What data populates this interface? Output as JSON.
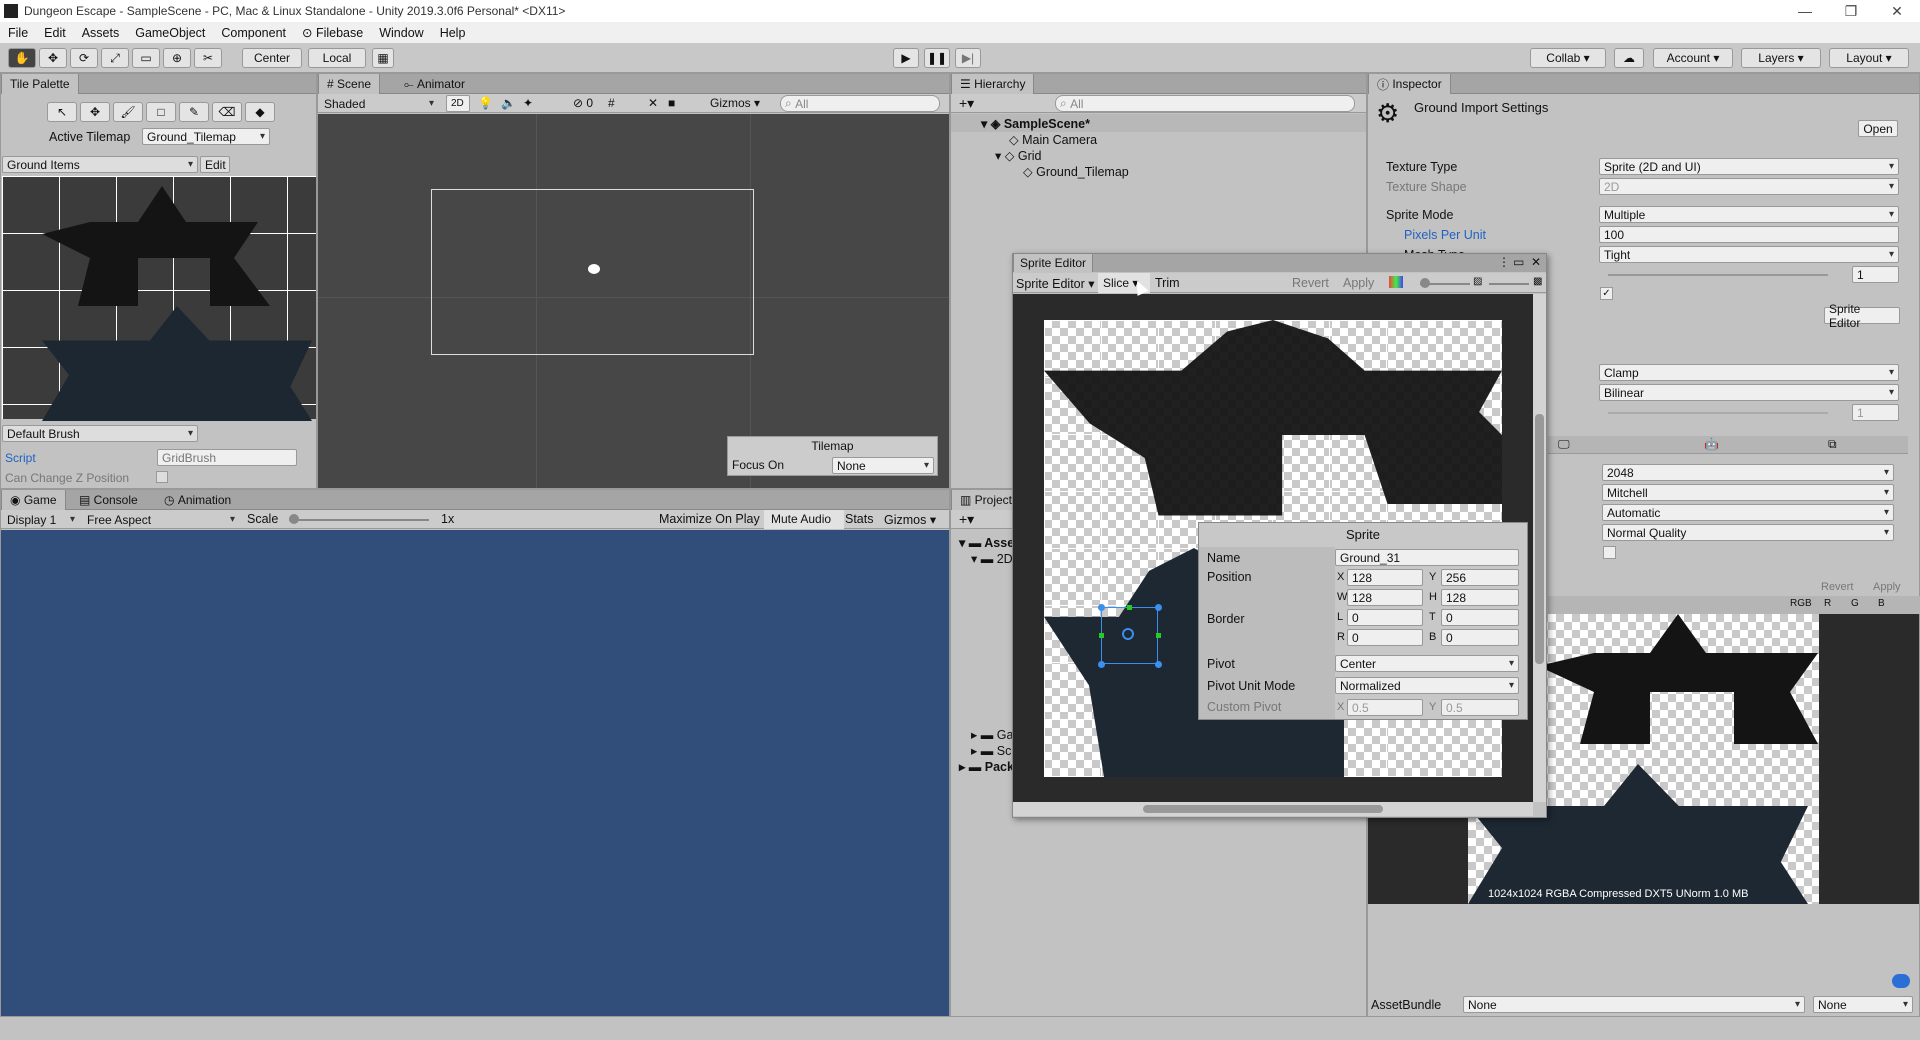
{
  "window": {
    "title": "Dungeon Escape - SampleScene - PC, Mac & Linux Standalone - Unity 2019.3.0f6 Personal* <DX11>"
  },
  "menu": [
    "File",
    "Edit",
    "Assets",
    "GameObject",
    "Component",
    "⊙ Filebase",
    "Window",
    "Help"
  ],
  "toolbar": {
    "center": "Center",
    "local": "Local",
    "collab": "Collab",
    "account": "Account",
    "layers": "Layers",
    "layout": "Layout"
  },
  "tile_palette": {
    "tab": "Tile Palette",
    "active_tilemap_label": "Active Tilemap",
    "active_tilemap": "Ground_Tilemap",
    "palette": "Ground Items",
    "edit": "Edit",
    "brush": "Default Brush",
    "script_label": "Script",
    "script_value": "GridBrush",
    "z_label": "Can Change Z Position"
  },
  "scene": {
    "tab": "Scene",
    "animator_tab": "Animator",
    "shading": "Shaded",
    "mode2d": "2D",
    "fx_count": "0",
    "gizmos": "Gizmos",
    "search": "All",
    "overlay_title": "Tilemap",
    "focus_label": "Focus On",
    "focus_value": "None"
  },
  "hierarchy": {
    "tab": "Hierarchy",
    "search": "All",
    "scene": "SampleScene*",
    "items": [
      "Main Camera",
      "Grid",
      "Ground_Tilemap"
    ]
  },
  "game": {
    "tabs": [
      "Game",
      "Console",
      "Animation"
    ],
    "display": "Display 1",
    "aspect": "Free Aspect",
    "scale_label": "Scale",
    "scale_value": "1x",
    "maximize": "Maximize On Play",
    "mute": "Mute Audio",
    "stats": "Stats",
    "gizmos": "Gizmos"
  },
  "project": {
    "tab": "Project",
    "items": [
      "Asse",
      "2D",
      "Ga",
      "Sc",
      "Pack"
    ]
  },
  "inspector": {
    "tab": "Inspector",
    "title": "Ground Import Settings",
    "open": "Open",
    "rows": [
      {
        "label": "Texture Type",
        "value": "Sprite (2D and UI)"
      },
      {
        "label": "Texture Shape",
        "value": "2D"
      },
      {
        "label": "Sprite Mode",
        "value": "Multiple"
      },
      {
        "label": "Pixels Per Unit",
        "value": "100"
      },
      {
        "label": "Mesh Type",
        "value": "Tight"
      }
    ],
    "extrude": "1",
    "sprite_editor_btn": "Sprite Editor",
    "wrap": "Clamp",
    "filter": "Bilinear",
    "aniso": "1",
    "platform": [
      "2048",
      "Mitchell",
      "Automatic",
      "Normal Quality"
    ],
    "revert": "Revert",
    "apply": "Apply",
    "channels": [
      "RGB",
      "R",
      "G",
      "B"
    ],
    "preview_info": "1024x1024  RGBA Compressed DXT5 UNorm  1.0 MB",
    "assetbundle_label": "AssetBundle",
    "assetbundle": "None",
    "variant": "None"
  },
  "sprite_editor": {
    "title": "Sprite Editor",
    "mode": "Sprite Editor",
    "slice": "Slice",
    "trim": "Trim",
    "revert": "Revert",
    "apply": "Apply",
    "sprite_panel": {
      "title": "Sprite",
      "name_label": "Name",
      "name": "Ground_31",
      "position_label": "Position",
      "x": "128",
      "y": "256",
      "w": "128",
      "h": "128",
      "border_label": "Border",
      "l": "0",
      "t": "0",
      "r": "0",
      "b": "0",
      "pivot_label": "Pivot",
      "pivot": "Center",
      "pivot_unit_label": "Pivot Unit Mode",
      "pivot_unit": "Normalized",
      "custom_pivot_label": "Custom Pivot",
      "cx": "0.5",
      "cy": "0.5"
    }
  },
  "colors": {
    "game_bg": "#314d79",
    "scene_bg": "#474747",
    "dark_tile": "#151515",
    "blue_tile": "#1d2833"
  }
}
